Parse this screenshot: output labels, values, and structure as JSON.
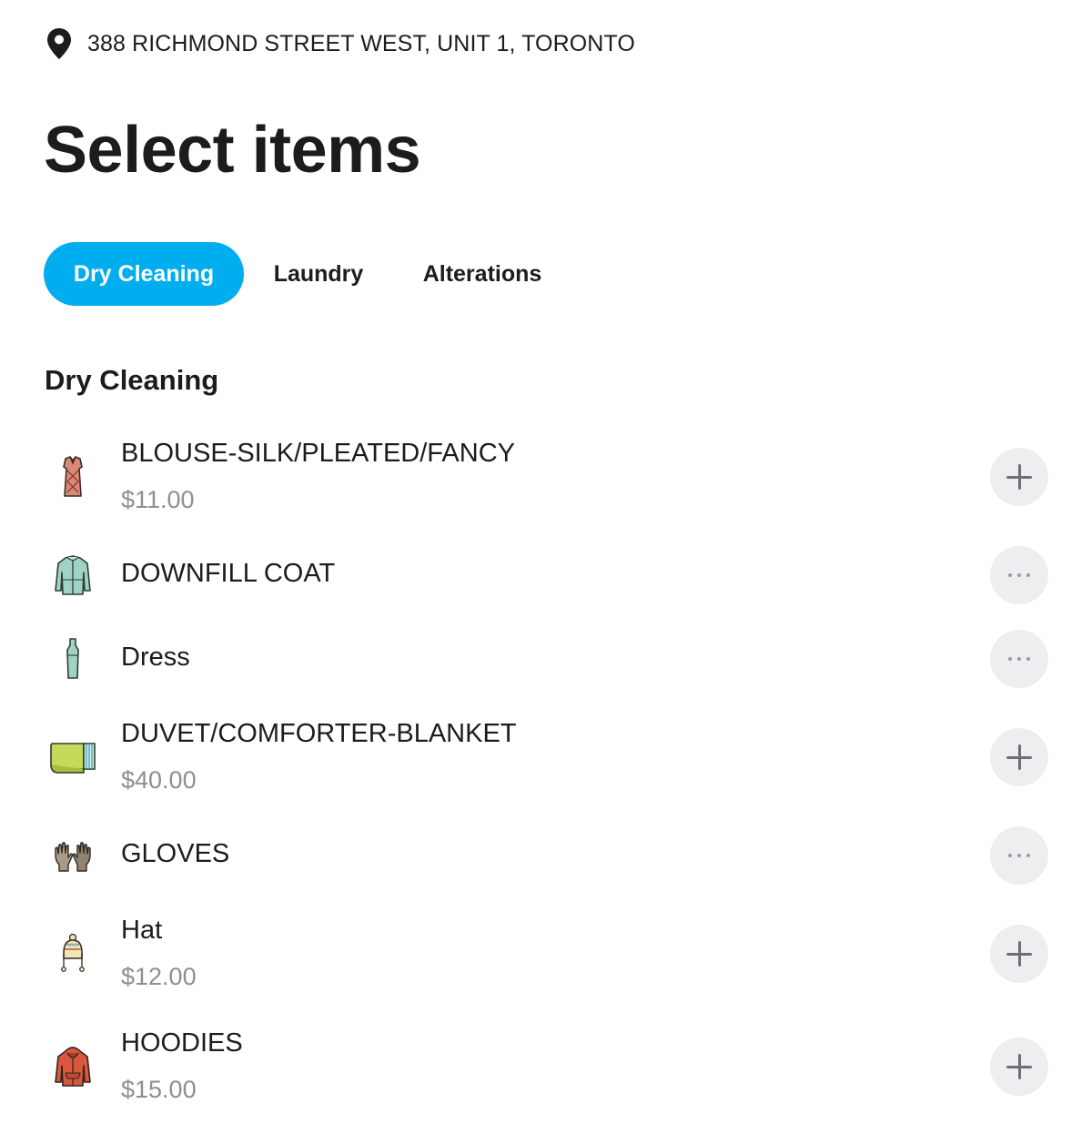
{
  "address": {
    "icon": "location-pin-icon",
    "text": "388 RICHMOND STREET WEST, UNIT 1, TORONTO"
  },
  "page": {
    "title": "Select items"
  },
  "tabs": [
    {
      "label": "Dry Cleaning",
      "active": true
    },
    {
      "label": "Laundry",
      "active": false
    },
    {
      "label": "Alterations",
      "active": false
    }
  ],
  "colors": {
    "accent": "#00adee",
    "button_bg": "#eeeef0",
    "price_text": "#8e8e93"
  },
  "section": {
    "title": "Dry Cleaning",
    "items": [
      {
        "name": "BLOUSE-SILK/PLEATED/FANCY",
        "price": "$11.00",
        "icon": "blouse-icon",
        "action": "add-icon"
      },
      {
        "name": "DOWNFILL COAT",
        "price": null,
        "icon": "coat-icon",
        "action": "more-icon"
      },
      {
        "name": "Dress",
        "price": null,
        "icon": "dress-icon",
        "action": "more-icon"
      },
      {
        "name": "DUVET/COMFORTER-BLANKET",
        "price": "$40.00",
        "icon": "blanket-icon",
        "action": "add-icon"
      },
      {
        "name": "GLOVES",
        "price": null,
        "icon": "gloves-icon",
        "action": "more-icon"
      },
      {
        "name": "Hat",
        "price": "$12.00",
        "icon": "hat-icon",
        "action": "add-icon"
      },
      {
        "name": "HOODIES",
        "price": "$15.00",
        "icon": "hoodie-icon",
        "action": "add-icon"
      }
    ]
  }
}
